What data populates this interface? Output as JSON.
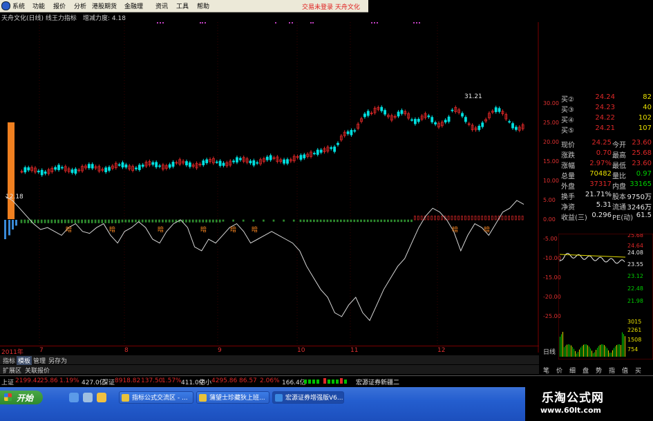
{
  "menu": {
    "items": [
      "系统",
      "功能",
      "报价",
      "分析",
      "港股期货",
      "金融理",
      "资讯",
      "工具",
      "帮助"
    ],
    "login_status": "交易未登录  天舟文化"
  },
  "header": {
    "title": "天舟文化(日线) 线王力指标",
    "indicator_label": "增减力度: 4.18"
  },
  "chart_data": {
    "type": "candlestick",
    "price_axis_ticks": [
      "30.00",
      "25.00",
      "20.00",
      "15.00",
      "10.00",
      "5.00",
      "0.00",
      "-5.00",
      "-10.00",
      "-15.00",
      "-20.00",
      "-25.00"
    ],
    "annotations": [
      "31.21",
      "12.18"
    ],
    "time_labels": [
      "2011年",
      "7",
      "8",
      "9",
      "10",
      "11",
      "12"
    ],
    "marker_label": "暗"
  },
  "quote": {
    "rows": [
      {
        "label": "买②",
        "value": "24.24",
        "vol": "82"
      },
      {
        "label": "买③",
        "value": "24.23",
        "vol": "40"
      },
      {
        "label": "买④",
        "value": "24.22",
        "vol": "102"
      },
      {
        "label": "买⑤",
        "value": "24.21",
        "vol": "107"
      }
    ],
    "stats": [
      {
        "l1": "现价",
        "v1": "24.25",
        "l2": "今开",
        "v2": "23.60"
      },
      {
        "l1": "涨跌",
        "v1": "0.70",
        "l2": "最高",
        "v2": "25.68"
      },
      {
        "l1": "涨幅",
        "v1": "2.97%",
        "l2": "最低",
        "v2": "23.60"
      },
      {
        "l1": "总量",
        "v1": "70482",
        "l2": "量比",
        "v2": "0.97"
      },
      {
        "l1": "外盘",
        "v1": "37317",
        "l2": "内盘",
        "v2": "33165"
      },
      {
        "l1": "换手",
        "v1": "21.71%",
        "l2": "股本",
        "v2": "9750万"
      },
      {
        "l1": "净资",
        "v1": "5.31",
        "l2": "流通",
        "v2": "3246万"
      },
      {
        "l1": "收益(三)",
        "v1": "0.296",
        "l2": "PE(动)",
        "v2": "61.5"
      }
    ],
    "intraday_ticks": [
      "25.68",
      "24.64",
      "24.08",
      "23.55",
      "23.12",
      "22.48",
      "21.98",
      "3015",
      "2261",
      "1508",
      "754"
    ]
  },
  "tabs": {
    "row1": [
      "指标",
      "模板",
      "管理",
      "另存为"
    ],
    "row2": [
      "扩展区",
      "关联报价"
    ],
    "cycle": "日线",
    "right": [
      "笔",
      "价",
      "细",
      "盘",
      "势",
      "指",
      "值",
      "买"
    ]
  },
  "ticker": {
    "sh_label": "上证",
    "sh_value": "2199.42",
    "sh_chg": "25.86",
    "sh_pct": "1.19%",
    "sh_amt": "427.0亿",
    "sz_label": "深证",
    "sz_value": "8918.82",
    "sz_chg": "137.50",
    "sz_pct": "1.57%",
    "sz_amt": "411.0亿",
    "zx_label": "中小",
    "zx_value": "4295.86",
    "zx_chg": "86.57",
    "zx_pct": "2.06%",
    "zx_amt": "166.4亿",
    "news": "宏源证券新疆二"
  },
  "taskbar": {
    "start": "开始",
    "windows": [
      "指标公式交流区 - ...",
      "蒲望士珍藏狄上班...",
      "宏源证券增强版V6..."
    ]
  },
  "watermark": {
    "title": "乐淘公式网",
    "url": "www.60lt.com"
  },
  "colors": {
    "up": "#e02828",
    "down": "#00e0e0",
    "accent": "#e8e000",
    "line": "#d8d8d8"
  }
}
